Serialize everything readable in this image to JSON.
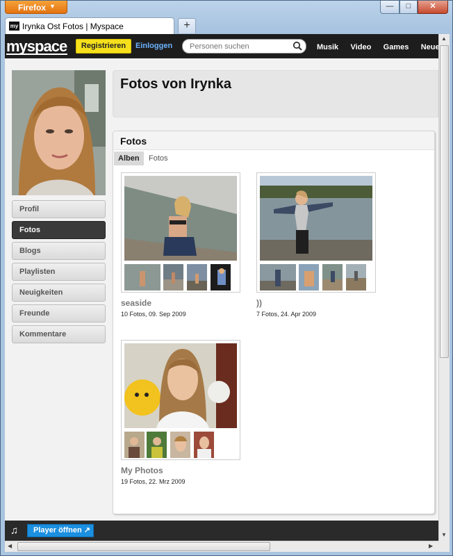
{
  "browser": {
    "menu_label": "Firefox",
    "tab_title": "Irynka Ost Fotos | Myspace",
    "tab_favicon_text": "my",
    "new_tab_label": "+",
    "win_min": "—",
    "win_max": "□",
    "win_close": "✕"
  },
  "nav": {
    "logo": "myspace",
    "register_label": "Registrieren",
    "login_label": "Einloggen",
    "search_placeholder": "Personen suchen",
    "links": [
      "Musik",
      "Video",
      "Games",
      "Neue L"
    ]
  },
  "sidebar": {
    "items": [
      {
        "label": "Profil",
        "active": false
      },
      {
        "label": "Fotos",
        "active": true
      },
      {
        "label": "Blogs",
        "active": false
      },
      {
        "label": "Playlisten",
        "active": false
      },
      {
        "label": "Neuigkeiten",
        "active": false
      },
      {
        "label": "Freunde",
        "active": false
      },
      {
        "label": "Kommentare",
        "active": false
      }
    ]
  },
  "header": {
    "title": "Fotos von Irynka"
  },
  "photos": {
    "title": "Fotos",
    "tabs": [
      "Alben",
      "Fotos"
    ],
    "albums": [
      {
        "title": "seaside",
        "meta": "10 Fotos, 09. Sep 2009"
      },
      {
        "title": "))",
        "meta": "7 Fotos, 24. Apr 2009"
      },
      {
        "title": "My Photos",
        "meta": "19 Fotos, 22. Mrz 2009"
      }
    ]
  },
  "player": {
    "button_label": "Player öffnen ↗",
    "note_icon": "♫"
  },
  "colors": {
    "nav_bg": "#1d1d1d",
    "register_yellow": "#f5e01b",
    "login_blue": "#6db3ff",
    "player_blue": "#1b8fe0",
    "firefox_orange": "#e37310"
  }
}
